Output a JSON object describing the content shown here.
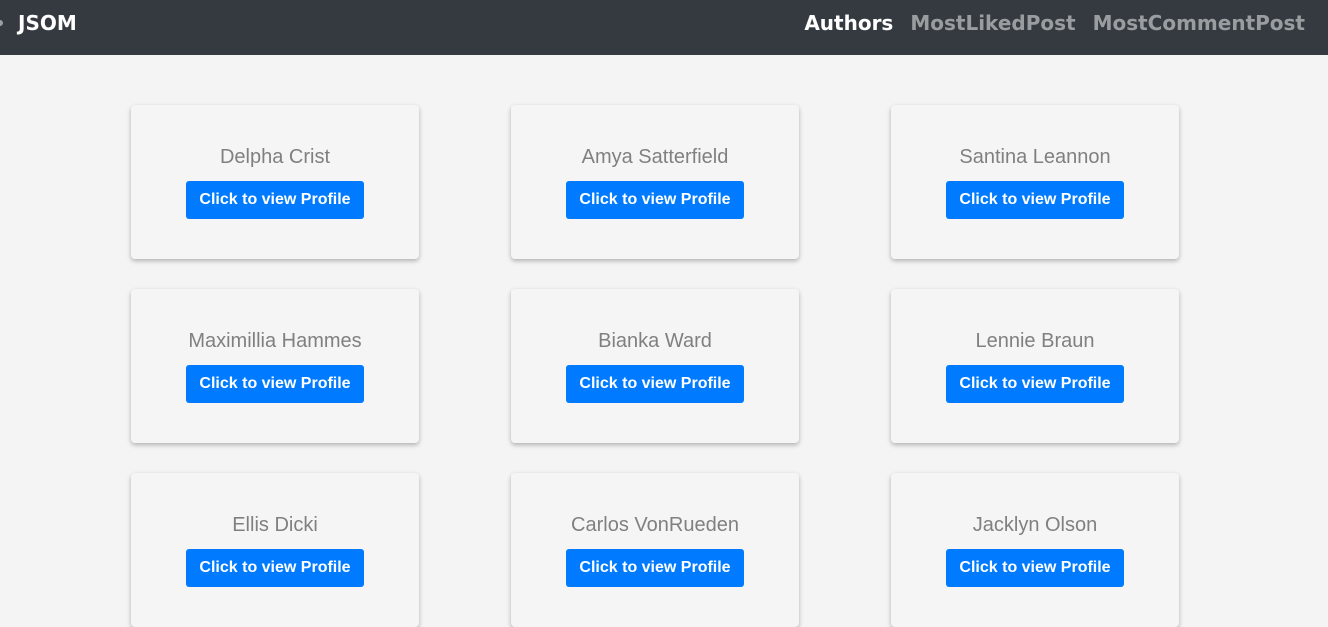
{
  "navbar": {
    "brand": "JSOM",
    "links": [
      {
        "label": "Authors",
        "active": true
      },
      {
        "label": "MostLikedPost",
        "active": false
      },
      {
        "label": "MostCommentPost",
        "active": false
      }
    ]
  },
  "authors": [
    {
      "name": "Delpha Crist",
      "button": "Click to view Profile"
    },
    {
      "name": "Amya Satterfield",
      "button": "Click to view Profile"
    },
    {
      "name": "Santina Leannon",
      "button": "Click to view Profile"
    },
    {
      "name": "Maximillia Hammes",
      "button": "Click to view Profile"
    },
    {
      "name": "Bianka Ward",
      "button": "Click to view Profile"
    },
    {
      "name": "Lennie Braun",
      "button": "Click to view Profile"
    },
    {
      "name": "Ellis Dicki",
      "button": "Click to view Profile"
    },
    {
      "name": "Carlos VonRueden",
      "button": "Click to view Profile"
    },
    {
      "name": "Jacklyn Olson",
      "button": "Click to view Profile"
    }
  ],
  "colors": {
    "navbar_bg": "#343a40",
    "primary": "#007bff",
    "page_bg": "#f4f4f4"
  }
}
